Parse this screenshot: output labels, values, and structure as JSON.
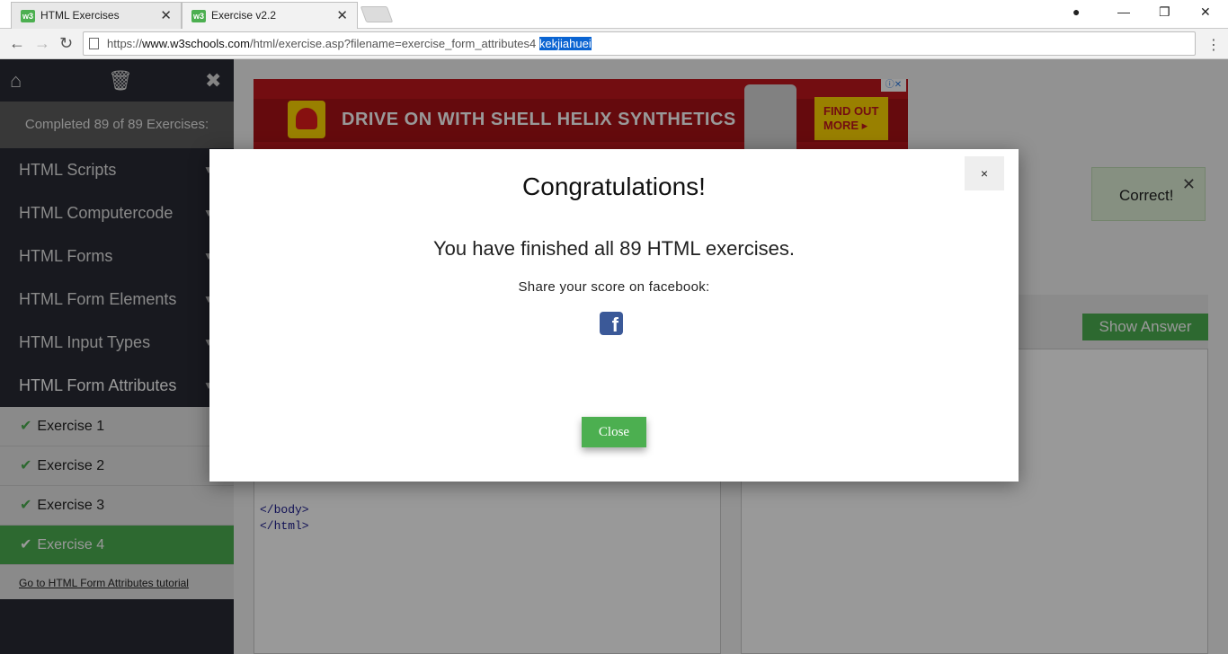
{
  "browser": {
    "tabs": [
      {
        "title": "HTML Exercises",
        "favicon": "w3",
        "active": false
      },
      {
        "title": "Exercise v2.2",
        "favicon": "w3",
        "active": true
      }
    ],
    "url_prefix": "https://",
    "url_domain": "www.w3schools.com",
    "url_path": "/html/exercise.asp?filename=exercise_form_attributes4",
    "url_selected": "kekjiahuei",
    "icons": {
      "back": "arrow-left-icon",
      "forward": "arrow-right-icon",
      "reload": "reload-icon",
      "account": "account-icon",
      "menu": "kebab-menu-icon"
    }
  },
  "sidebar": {
    "completed": "Completed 89 of 89 Exercises:",
    "categories": [
      {
        "label": "HTML Scripts"
      },
      {
        "label": "HTML Computercode"
      },
      {
        "label": "HTML Forms"
      },
      {
        "label": "HTML Form Elements"
      },
      {
        "label": "HTML Input Types"
      },
      {
        "label": "HTML Form Attributes"
      }
    ],
    "exercises": [
      {
        "label": "Exercise 1",
        "done": true
      },
      {
        "label": "Exercise 2",
        "done": true
      },
      {
        "label": "Exercise 3",
        "done": true
      },
      {
        "label": "Exercise 4",
        "done": true,
        "current": true
      }
    ],
    "tutorial_link": "Go to HTML Form Attributes tutorial"
  },
  "content": {
    "ad": {
      "headline": "DRIVE ON WITH SHELL HELIX SYNTHETICS",
      "cta_line1": "FIND OUT",
      "cta_line2": "MORE ▸"
    },
    "correct_alert": "Correct!",
    "show_answer": "Show Answer",
    "code_lines": [
      "</body>",
      "</html>"
    ]
  },
  "modal": {
    "title": "Congratulations!",
    "message": "You have finished all 89 HTML exercises.",
    "share": "Share your score on facebook:",
    "close_x": "×",
    "close_button": "Close"
  },
  "colors": {
    "sidebar_bg": "#282a35",
    "accent_green": "#4caf50",
    "facebook_blue": "#3b5998",
    "url_selection": "#0a64d2"
  }
}
